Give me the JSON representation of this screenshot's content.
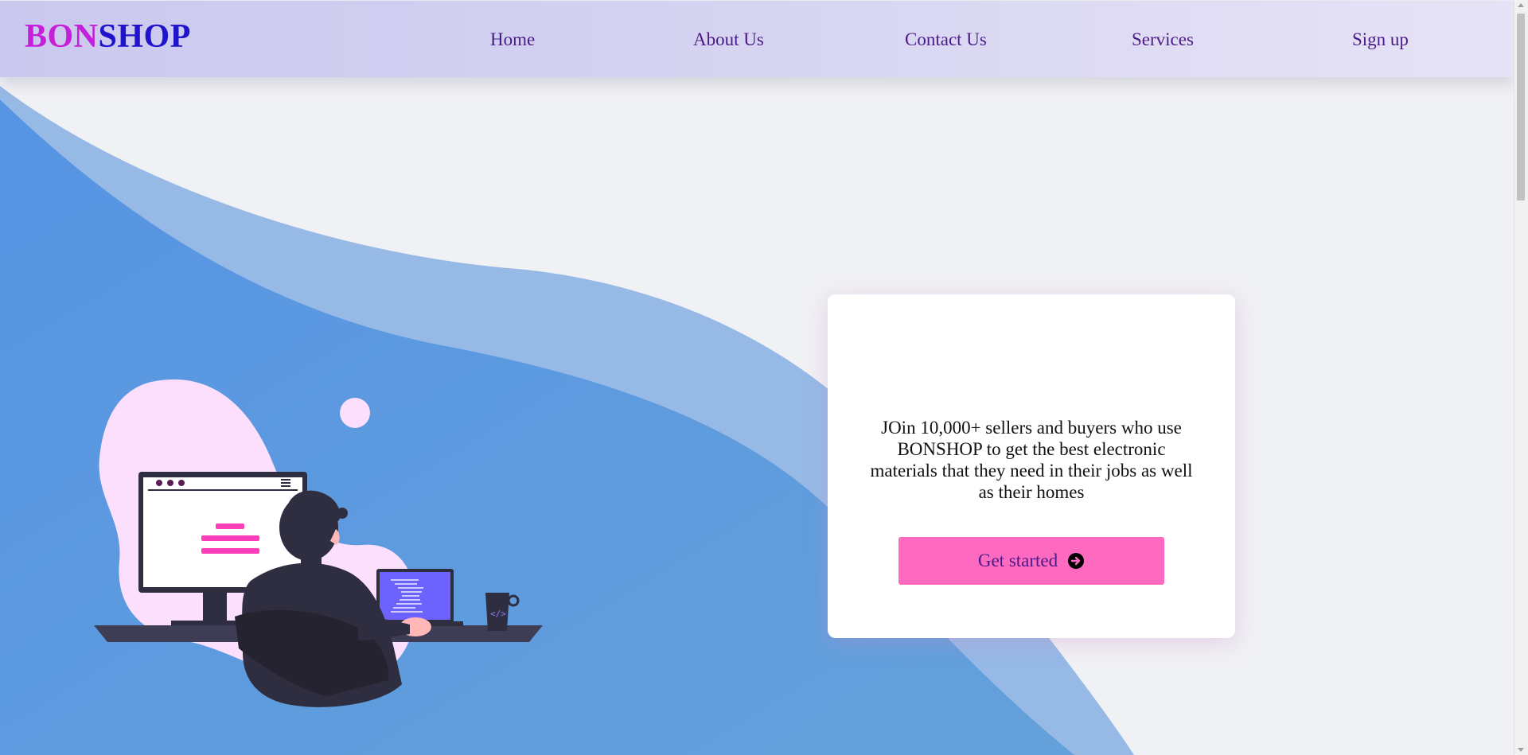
{
  "brand": {
    "part1": "BON",
    "part2": "SHOP"
  },
  "nav": {
    "home": "Home",
    "about": "About Us",
    "contact": "Contact Us",
    "services": "Services",
    "signup": "Sign up"
  },
  "hero": {
    "text": "JOin 10,000+ sellers and buyers who use BONSHOP to get the best electronic materials that they need in their jobs as well as their homes",
    "cta_label": "Get started"
  },
  "icons": {
    "cta_icon": "arrow-circle-right-icon",
    "illustration": "person-at-computer-illustration"
  },
  "colors": {
    "brand_magenta": "#c51fd9",
    "brand_blue": "#1f14c9",
    "nav_text": "#4a1b86",
    "cta_bg": "#ff6ac1",
    "wave_dark": "#5b9ae2",
    "wave_light": "#96b9e6",
    "page_bg": "#f0f1f4"
  }
}
